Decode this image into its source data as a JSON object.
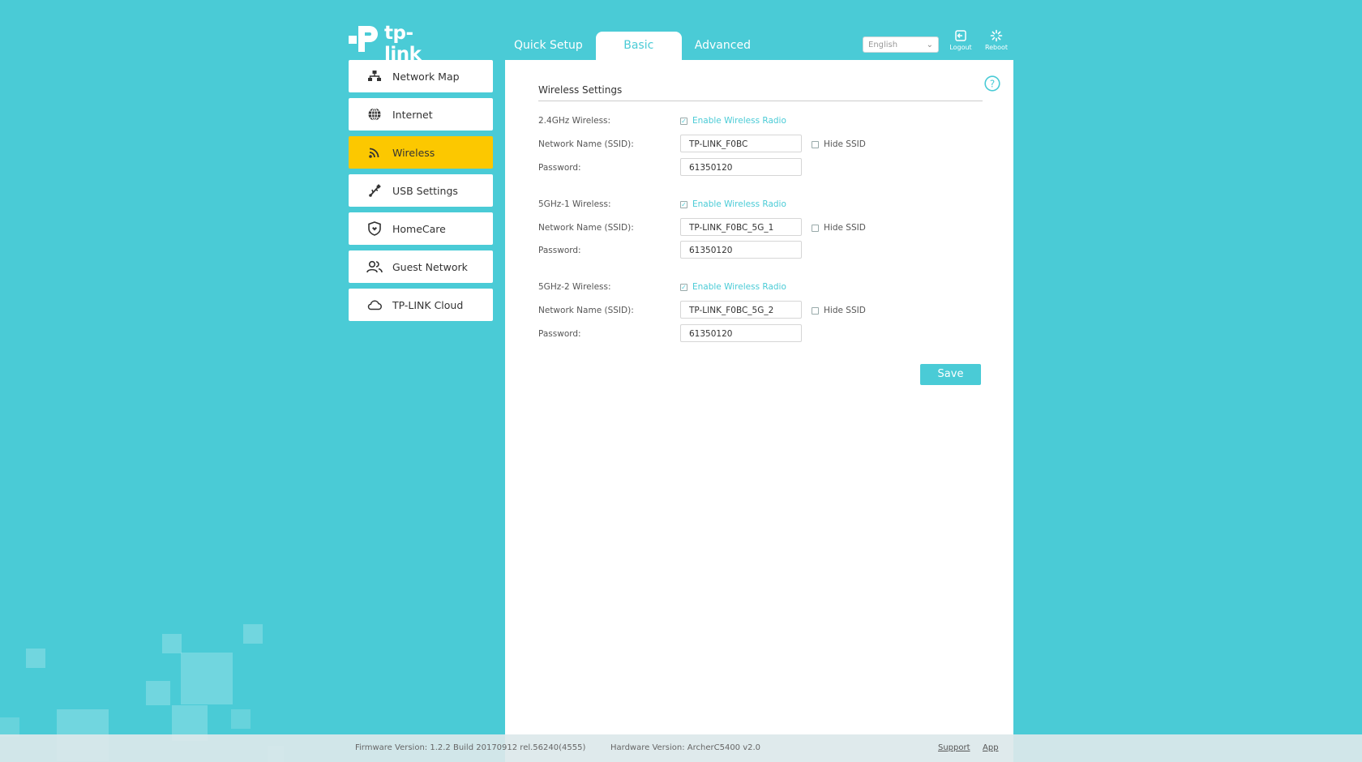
{
  "header": {
    "logo_text": "tp-link",
    "tabs": [
      {
        "label": "Quick Setup"
      },
      {
        "label": "Basic"
      },
      {
        "label": "Advanced"
      }
    ],
    "language": "English",
    "logout_label": "Logout",
    "reboot_label": "Reboot"
  },
  "sidebar": {
    "items": [
      {
        "label": "Network Map",
        "icon": "network-map-icon"
      },
      {
        "label": "Internet",
        "icon": "globe-icon"
      },
      {
        "label": "Wireless",
        "icon": "wifi-icon"
      },
      {
        "label": "USB Settings",
        "icon": "usb-icon"
      },
      {
        "label": "HomeCare",
        "icon": "shield-icon"
      },
      {
        "label": "Guest Network",
        "icon": "guest-icon"
      },
      {
        "label": "TP-LINK Cloud",
        "icon": "cloud-icon"
      }
    ],
    "active_index": 2
  },
  "main": {
    "section_title": "Wireless Settings",
    "bands": [
      {
        "band_label": "2.4GHz Wireless:",
        "enable_label": "Enable Wireless Radio",
        "ssid_label": "Network Name (SSID):",
        "ssid_value": "TP-LINK_F0BC",
        "hide_label": "Hide SSID",
        "password_label": "Password:",
        "password_value": "61350120"
      },
      {
        "band_label": "5GHz-1 Wireless:",
        "enable_label": "Enable Wireless Radio",
        "ssid_label": "Network Name (SSID):",
        "ssid_value": "TP-LINK_F0BC_5G_1",
        "hide_label": "Hide SSID",
        "password_label": "Password:",
        "password_value": "61350120"
      },
      {
        "band_label": "5GHz-2 Wireless:",
        "enable_label": "Enable Wireless Radio",
        "ssid_label": "Network Name (SSID):",
        "ssid_value": "TP-LINK_F0BC_5G_2",
        "hide_label": "Hide SSID",
        "password_label": "Password:",
        "password_value": "61350120"
      }
    ],
    "save_label": "Save"
  },
  "footer": {
    "firmware": "Firmware Version: 1.2.2 Build 20170912 rel.56240(4555)",
    "hardware": "Hardware Version: ArcherC5400 v2.0",
    "support": "Support",
    "app": "App"
  },
  "colors": {
    "accent": "#4acbd6",
    "active_nav": "#fcc800"
  }
}
